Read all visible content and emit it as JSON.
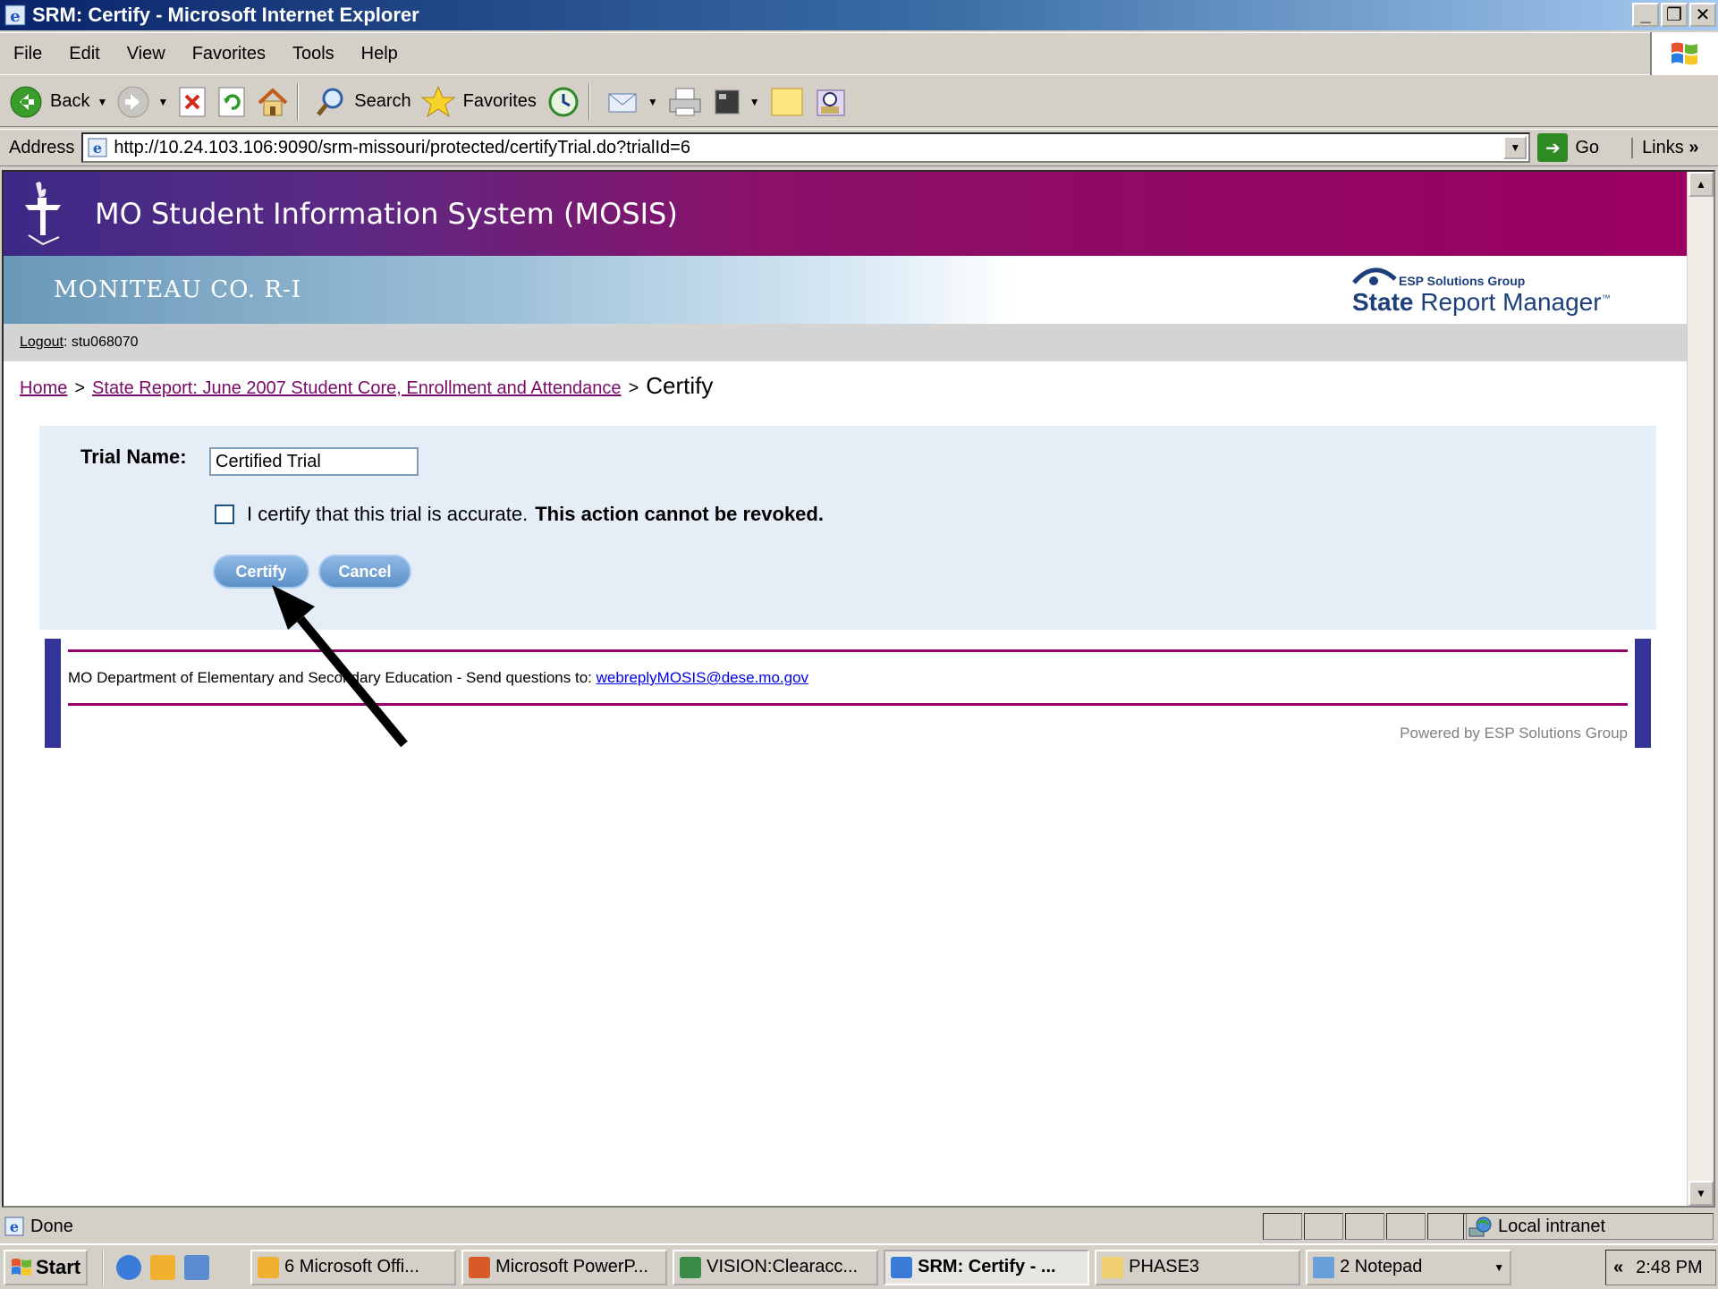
{
  "window": {
    "title": "SRM: Certify - Microsoft Internet Explorer",
    "buttons": [
      "_",
      "❐",
      "✕"
    ]
  },
  "menu": [
    "File",
    "Edit",
    "View",
    "Favorites",
    "Tools",
    "Help"
  ],
  "toolbar": {
    "back_label": "Back",
    "search_label": "Search",
    "favorites_label": "Favorites"
  },
  "address": {
    "label": "Address",
    "url": "http://10.24.103.106:9090/srm-missouri/protected/certifyTrial.do?trialId=6",
    "go_label": "Go",
    "links_label": "Links"
  },
  "page": {
    "system_title": "MO Student Information System (MOSIS)",
    "district": "MONITEAU CO. R-I",
    "logo_small": "ESP Solutions Group",
    "logo_state": "State",
    "logo_rest": "Report Manager",
    "logo_tm": "™",
    "logout_label": "Logout",
    "username": ": stu068070",
    "breadcrumb": {
      "home": "Home",
      "separator": ">",
      "report": "State Report: June 2007 Student Core, Enrollment and Attendance",
      "current": "Certify"
    },
    "form": {
      "trial_name_label": "Trial Name:",
      "trial_name_value": "Certified Trial",
      "certify_text": "I certify that this trial is accurate.",
      "warning_text": "This action cannot be revoked.",
      "certify_checked": false,
      "certify_button": "Certify",
      "cancel_button": "Cancel"
    },
    "footer": {
      "info_text": "MO Department of Elementary and Secondary Education - Send questions to:",
      "email": "webreplyMOSIS@dese.mo.gov",
      "powered": "Powered by ESP Solutions Group"
    }
  },
  "status": {
    "text": "Done",
    "zone": "Local intranet"
  },
  "taskbar": {
    "start": "Start",
    "tasks": [
      {
        "label": "6 Microsoft Offi...",
        "active": false
      },
      {
        "label": "Microsoft PowerP...",
        "active": false
      },
      {
        "label": "VISION:Clearacc...",
        "active": false
      },
      {
        "label": "SRM: Certify - ...",
        "active": true
      },
      {
        "label": "PHASE3",
        "active": false
      },
      {
        "label": "2 Notepad",
        "active": false
      }
    ],
    "tray_chevron": "«",
    "clock": "2:48 PM"
  },
  "colors": {
    "banner_purple": "#9b0060",
    "link_purple": "#7a0a6a",
    "footer_bar": "#343498",
    "form_bg": "#e5eef6"
  }
}
